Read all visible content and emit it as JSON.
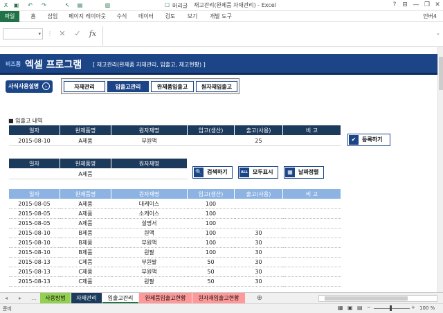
{
  "titlebar": {
    "title": "재고관리(완제품 자재관리) - Excel",
    "window_controls": [
      "?",
      "⊟",
      "—",
      "❐",
      "✕"
    ]
  },
  "ribbon": {
    "tabs": [
      "파일",
      "홈",
      "삽입",
      "페이지 레이아웃",
      "수식",
      "데이터",
      "검토",
      "보기",
      "개발 도구"
    ],
    "user": "인버4",
    "toolbar_quick": {
      "font_label": "머리글"
    }
  },
  "formula": {
    "namebox_value": "",
    "fx_label": "fx",
    "value": ""
  },
  "header": {
    "logo_small": "비즈폼",
    "logo_big": "엑셀 프로그램",
    "subtitle": "[ 재고관리(완제품 자재관리, 입출고, 재고현황) ]"
  },
  "manual_button": {
    "label": "사식사용설명",
    "icon": "chevron-right-icon"
  },
  "nav_tabs": [
    {
      "label": "자재관리",
      "active": false
    },
    {
      "label": "입출고관리",
      "active": true
    },
    {
      "label": "완제품입출고",
      "active": false
    },
    {
      "label": "원자재입출고",
      "active": false
    }
  ],
  "section_title": "■ 입출고 내역",
  "entry_table": {
    "columns": [
      "일자",
      "완제품명",
      "원자재명",
      "입고(생산)",
      "출고(사용)",
      "비 고"
    ],
    "row": [
      "2015-08-10",
      "A제품",
      "부원액",
      "",
      "25",
      ""
    ]
  },
  "register_button": {
    "label": "등록하기",
    "icon": "check-icon"
  },
  "filter_table": {
    "columns": [
      "일자",
      "완제품명",
      "원자재명"
    ],
    "row": [
      "",
      "A제품",
      ""
    ]
  },
  "filter_buttons": [
    {
      "label": "검색하기",
      "icon": "search-icon",
      "icon_text": "🔍"
    },
    {
      "label": "모두표시",
      "icon": "all-icon",
      "icon_text": "ALL"
    },
    {
      "label": "날짜정렬",
      "icon": "calendar-icon",
      "icon_text": "▦"
    }
  ],
  "list_table": {
    "columns": [
      "일자",
      "완제품명",
      "원자재명",
      "입고(생산)",
      "출고(사용)",
      "비 고"
    ],
    "rows": [
      [
        "2015-08-05",
        "A제품",
        "대케이스",
        "100",
        "",
        ""
      ],
      [
        "2015-08-05",
        "A제품",
        "소케이스",
        "100",
        "",
        ""
      ],
      [
        "2015-08-05",
        "A제품",
        "설명서",
        "100",
        "",
        ""
      ],
      [
        "2015-08-10",
        "B제품",
        "원액",
        "100",
        "30",
        ""
      ],
      [
        "2015-08-10",
        "B제품",
        "부원액",
        "100",
        "30",
        ""
      ],
      [
        "2015-08-10",
        "B제품",
        "원팔",
        "100",
        "30",
        ""
      ],
      [
        "2015-08-13",
        "C제품",
        "부원팔",
        "50",
        "30",
        ""
      ],
      [
        "2015-08-13",
        "C제품",
        "부원액",
        "50",
        "30",
        ""
      ],
      [
        "2015-08-13",
        "C제품",
        "원팔",
        "50",
        "30",
        ""
      ]
    ]
  },
  "sheet_tabs": [
    {
      "label": "사용방법",
      "color": "#92d050"
    },
    {
      "label": "자재관리",
      "color": "#1c3a5c"
    },
    {
      "label": "입출고관리",
      "color": "#ffffff"
    },
    {
      "label": "완제품입출고현황",
      "color": "#ff9999"
    },
    {
      "label": "원자재입출고현황",
      "color": "#ff9999"
    }
  ],
  "status": {
    "left": "준비",
    "zoom": "100 %"
  }
}
